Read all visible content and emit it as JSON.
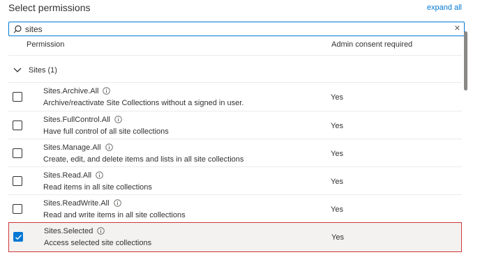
{
  "header": {
    "title": "Select permissions",
    "expand_all": "expand all"
  },
  "search": {
    "value": "sites",
    "placeholder": ""
  },
  "columns": {
    "permission": "Permission",
    "admin_consent": "Admin consent required"
  },
  "group": {
    "label": "Sites (1)",
    "expanded": true
  },
  "rows": [
    {
      "name": "Sites.Archive.All",
      "description": "Archive/reactivate Site Collections without a signed in user.",
      "admin": "Yes",
      "checked": false
    },
    {
      "name": "Sites.FullControl.All",
      "description": "Have full control of all site collections",
      "admin": "Yes",
      "checked": false
    },
    {
      "name": "Sites.Manage.All",
      "description": "Create, edit, and delete items and lists in all site collections",
      "admin": "Yes",
      "checked": false
    },
    {
      "name": "Sites.Read.All",
      "description": "Read items in all site collections",
      "admin": "Yes",
      "checked": false
    },
    {
      "name": "Sites.ReadWrite.All",
      "description": "Read and write items in all site collections",
      "admin": "Yes",
      "checked": false
    },
    {
      "name": "Sites.Selected",
      "description": "Access selected site collections",
      "admin": "Yes",
      "checked": true
    }
  ],
  "icons": {
    "search": "search-icon",
    "clear": "close-icon",
    "chevron": "chevron-down-icon",
    "info": "info-icon",
    "check": "checkmark-icon"
  },
  "colors": {
    "accent": "#0078d4",
    "highlight_border": "#d13438",
    "selected_bg": "#f3f2f1"
  }
}
